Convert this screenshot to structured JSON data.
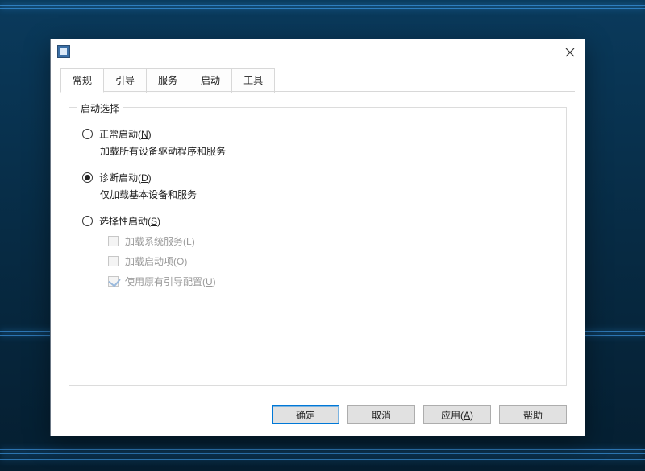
{
  "tabs": {
    "general": "常规",
    "boot": "引导",
    "services": "服务",
    "startup": "启动",
    "tools": "工具"
  },
  "group": {
    "title": "启动选择",
    "normal_label_pre": "正常启动(",
    "normal_label_key": "N",
    "normal_label_post": ")",
    "normal_desc": "加载所有设备驱动程序和服务",
    "diag_label_pre": "诊断启动(",
    "diag_label_key": "D",
    "diag_label_post": ")",
    "diag_desc": "仅加载基本设备和服务",
    "selective_label_pre": "选择性启动(",
    "selective_label_key": "S",
    "selective_label_post": ")",
    "chk_services_pre": "加载系统服务(",
    "chk_services_key": "L",
    "chk_services_post": ")",
    "chk_startup_pre": "加载启动项(",
    "chk_startup_key": "O",
    "chk_startup_post": ")",
    "chk_bootcfg_pre": "使用原有引导配置(",
    "chk_bootcfg_key": "U",
    "chk_bootcfg_post": ")"
  },
  "buttons": {
    "ok": "确定",
    "cancel": "取消",
    "apply_pre": "应用(",
    "apply_key": "A",
    "apply_post": ")",
    "help": "帮助"
  }
}
